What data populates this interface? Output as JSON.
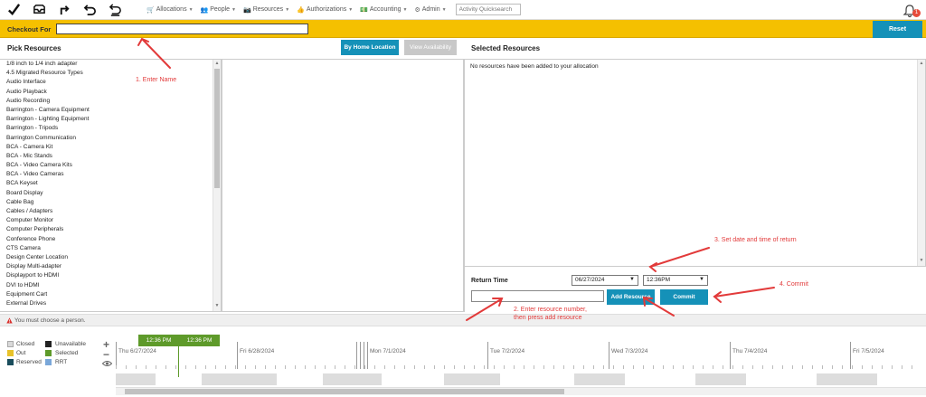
{
  "toolbar": {
    "icons": [
      "check-icon",
      "inbox-icon",
      "redirect-icon",
      "undo-icon",
      "undo-alt-icon"
    ]
  },
  "nav": {
    "menus": [
      {
        "label": "Allocations",
        "icon": "cart-icon"
      },
      {
        "label": "People",
        "icon": "people-icon"
      },
      {
        "label": "Resources",
        "icon": "camera-icon"
      },
      {
        "label": "Authorizations",
        "icon": "thumbs-up-icon"
      },
      {
        "label": "Accounting",
        "icon": "money-icon"
      },
      {
        "label": "Admin",
        "icon": "gear-icon"
      }
    ],
    "quicksearch_placeholder": "Activity Quicksearch",
    "notification_count": "1"
  },
  "checkout": {
    "label": "Checkout For",
    "value": "",
    "reset_label": "Reset"
  },
  "pick": {
    "title": "Pick Resources",
    "by_home_label": "By Home Location",
    "view_avail_label": "View Availability",
    "items": [
      "1/8 inch to 1/4 inch adapter",
      "4.5 Migrated Resource Types",
      "Audio Interface",
      "Audio Playback",
      "Audio Recording",
      "Barrington - Camera Equipment",
      "Barrington - Lighting Equipment",
      "Barrington - Tripods",
      "Barrington Communication",
      "BCA - Camera Kit",
      "BCA - Mic Stands",
      "BCA - Video Camera Kits",
      "BCA - Video Cameras",
      "BCA Keyset",
      "Board Display",
      "Cable Bag",
      "Cables / Adapters",
      "Computer Monitor",
      "Computer Peripherals",
      "Conference Phone",
      "CTS Camera",
      "Design Center Location",
      "Display Multi-adapter",
      "Displayport to HDMI",
      "DVI to HDMI",
      "Equipment Cart",
      "External Drives"
    ]
  },
  "selected": {
    "title": "Selected Resources",
    "empty_message": "No resources have been added to your allocation",
    "return_label": "Return Time",
    "return_date": "06/27/2024",
    "return_time": "12:36PM",
    "resource_number": "",
    "add_label": "Add Resource",
    "commit_label": "Commit"
  },
  "error": {
    "message": "You must choose a person."
  },
  "legend": {
    "closed": "Closed",
    "unavailable": "Unavailable",
    "out": "Out",
    "selected": "Selected",
    "reserved": "Reserved",
    "rrt": "RRT",
    "colors": {
      "closed": "#d9d9d9",
      "unavailable": "#222222",
      "out": "#e8c22a",
      "selected": "#5e9a2a",
      "reserved": "#1a4d5c",
      "rrt": "#7aa7d9"
    }
  },
  "timeline": {
    "start_time": "12:36 PM",
    "end_time": "12:36 PM",
    "days": [
      "Thu 6/27/2024",
      "Fri 6/28/2024",
      "Mon 7/1/2024",
      "Tue 7/2/2024",
      "Wed 7/3/2024",
      "Thu 7/4/2024",
      "Fri 7/5/2024"
    ]
  },
  "annotations": {
    "step1": "1. Enter Name",
    "step2_line1": "2. Enter resource number,",
    "step2_line2": "then press add resource",
    "step3": "3. Set date and time of return",
    "step4": "4. Commit"
  },
  "colors": {
    "accent": "#1591b8",
    "checkout_bar": "#f5c000",
    "annotation": "#e23a3a"
  }
}
